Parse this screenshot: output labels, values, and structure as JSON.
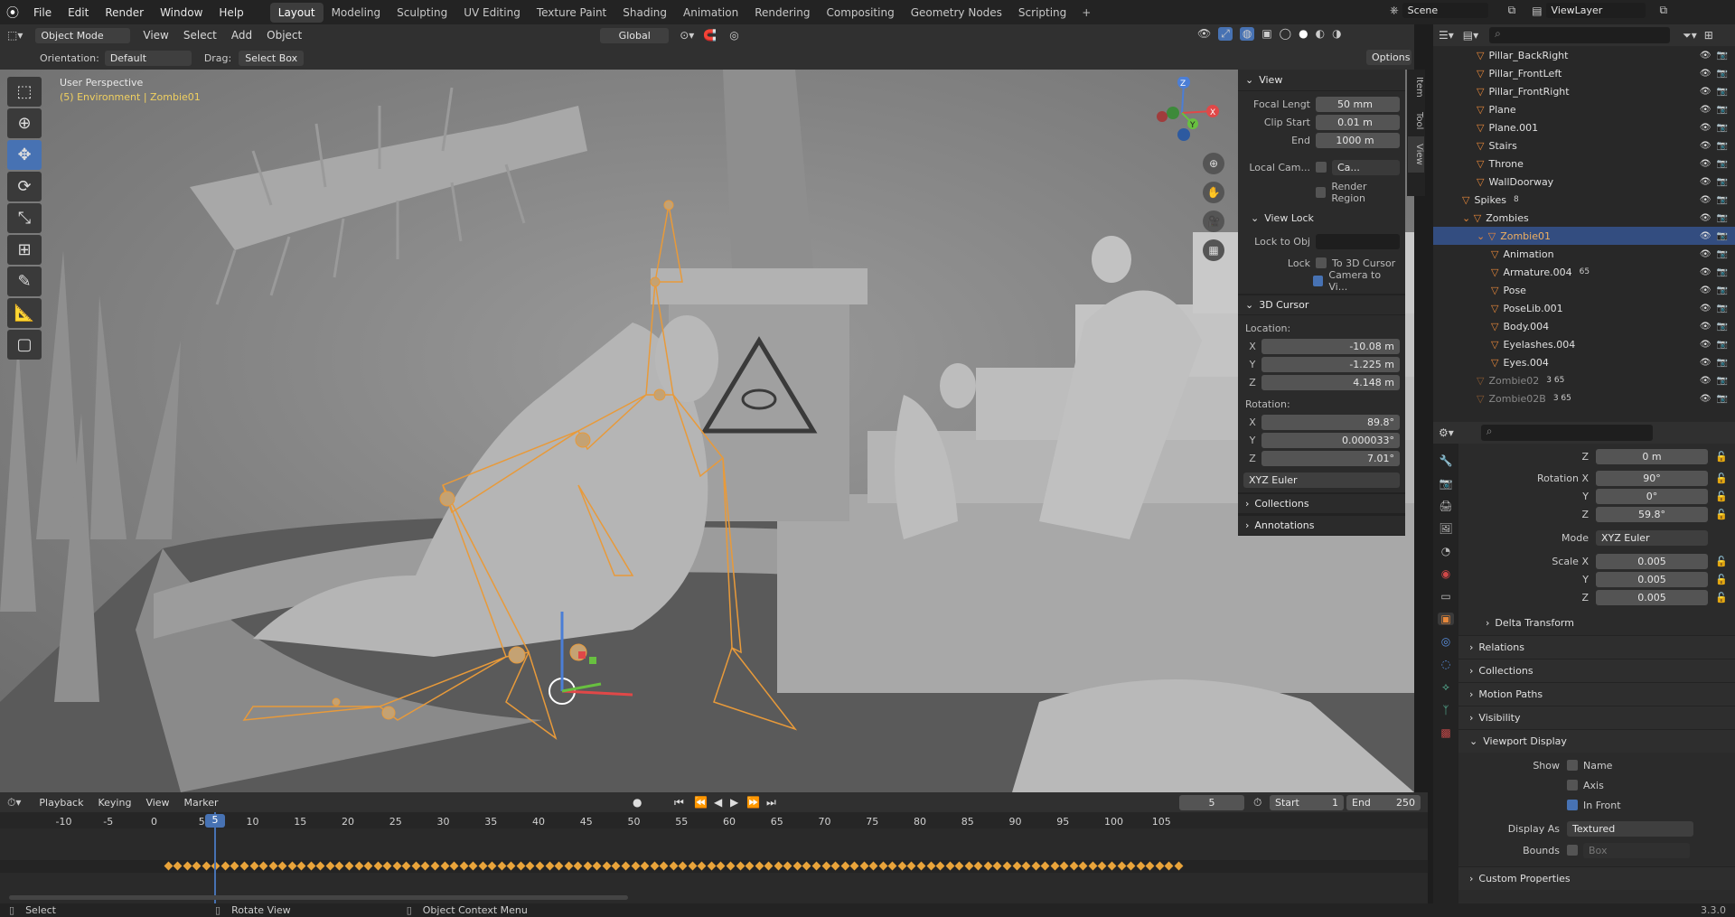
{
  "app": {
    "version": "3.3.0"
  },
  "menu": [
    "File",
    "Edit",
    "Render",
    "Window",
    "Help"
  ],
  "workspaces": [
    "Layout",
    "Modeling",
    "Sculpting",
    "UV Editing",
    "Texture Paint",
    "Shading",
    "Animation",
    "Rendering",
    "Compositing",
    "Geometry Nodes",
    "Scripting"
  ],
  "active_workspace": "Layout",
  "scene": "Scene",
  "view_layer": "ViewLayer",
  "viewport_header": {
    "mode": "Object Mode",
    "menus": [
      "View",
      "Select",
      "Add",
      "Object"
    ],
    "transform_orientation": "Global",
    "orientation_label": "Orientation:",
    "orientation_value": "Default",
    "drag_label": "Drag:",
    "drag_value": "Select Box",
    "options": "Options"
  },
  "viewport": {
    "perspective": "User Perspective",
    "context": "(5) Environment | Zombie01"
  },
  "npanel": {
    "tabs": [
      "Item",
      "Tool",
      "View"
    ],
    "view": {
      "title": "View",
      "focal_label": "Focal Lengt",
      "focal_value": "50 mm",
      "clip_start_label": "Clip Start",
      "clip_start_value": "0.01 m",
      "end_label": "End",
      "end_value": "1000 m",
      "local_cam_label": "Local Cam...",
      "local_cam_value": "Ca...",
      "render_region": "Render Region",
      "view_lock": "View Lock",
      "lock_obj_label": "Lock to Obj",
      "lock_label": "Lock",
      "to_cursor": "To 3D Cursor",
      "camera_to_view": "Camera to Vi..."
    },
    "cursor": {
      "title": "3D Cursor",
      "location_label": "Location:",
      "loc": [
        {
          "axis": "X",
          "value": "-10.08 m"
        },
        {
          "axis": "Y",
          "value": "-1.225 m"
        },
        {
          "axis": "Z",
          "value": "4.148 m"
        }
      ],
      "rotation_label": "Rotation:",
      "rot": [
        {
          "axis": "X",
          "value": "89.8°"
        },
        {
          "axis": "Y",
          "value": "0.000033°"
        },
        {
          "axis": "Z",
          "value": "7.01°"
        }
      ],
      "rot_mode": "XYZ Euler"
    },
    "collections": "Collections",
    "annotations": "Annotations"
  },
  "outliner": {
    "rows": [
      {
        "name": "Pillar_BackRight",
        "indent": 3
      },
      {
        "name": "Pillar_FrontLeft",
        "indent": 3
      },
      {
        "name": "Pillar_FrontRight",
        "indent": 3
      },
      {
        "name": "Plane",
        "indent": 3
      },
      {
        "name": "Plane.001",
        "indent": 3
      },
      {
        "name": "Stairs",
        "indent": 3
      },
      {
        "name": "Throne",
        "indent": 3
      },
      {
        "name": "WallDoorway",
        "indent": 3
      },
      {
        "name": "Spikes",
        "indent": 2,
        "badge": "8"
      },
      {
        "name": "Zombies",
        "indent": 2
      },
      {
        "name": "Zombie01",
        "indent": 3,
        "selected": true
      },
      {
        "name": "Animation",
        "indent": 4
      },
      {
        "name": "Armature.004",
        "indent": 4,
        "badge": "65"
      },
      {
        "name": "Pose",
        "indent": 4
      },
      {
        "name": "PoseLib.001",
        "indent": 4
      },
      {
        "name": "Body.004",
        "indent": 4
      },
      {
        "name": "Eyelashes.004",
        "indent": 4
      },
      {
        "name": "Eyes.004",
        "indent": 4
      },
      {
        "name": "Zombie02",
        "indent": 3,
        "dim": true,
        "badge": "3 65"
      },
      {
        "name": "Zombie02B",
        "indent": 3,
        "dim": true,
        "badge": "3 65"
      }
    ]
  },
  "properties": {
    "z_loc": {
      "label": "Z",
      "value": "0 m"
    },
    "rotation": [
      {
        "label": "Rotation X",
        "value": "90°"
      },
      {
        "label": "Y",
        "value": "0°"
      },
      {
        "label": "Z",
        "value": "59.8°"
      }
    ],
    "mode_label": "Mode",
    "mode_value": "XYZ Euler",
    "scale": [
      {
        "label": "Scale X",
        "value": "0.005"
      },
      {
        "label": "Y",
        "value": "0.005"
      },
      {
        "label": "Z",
        "value": "0.005"
      }
    ],
    "delta": "Delta Transform",
    "sections": [
      "Relations",
      "Collections",
      "Motion Paths",
      "Visibility"
    ],
    "viewport_display": "Viewport Display",
    "show_label": "Show",
    "show_name": "Name",
    "show_axis": "Axis",
    "in_front": "In Front",
    "display_as_label": "Display As",
    "display_as_value": "Textured",
    "bounds_label": "Bounds",
    "bounds_value": "Box",
    "custom": "Custom Properties"
  },
  "timeline": {
    "menus": [
      "Playback",
      "Keying",
      "View",
      "Marker"
    ],
    "current_frame": "5",
    "start_label": "Start",
    "start": "1",
    "end_label": "End",
    "end": "250",
    "ticks": [
      "-10",
      "-5",
      "0",
      "5",
      "10",
      "15",
      "20",
      "25",
      "30",
      "35",
      "40",
      "45",
      "50",
      "55",
      "60",
      "65",
      "70",
      "75",
      "80",
      "85",
      "90",
      "95",
      "100",
      "105"
    ]
  },
  "status": {
    "select": "Select",
    "rotate": "Rotate View",
    "context": "Object Context Menu",
    "version": "3.3.0"
  }
}
